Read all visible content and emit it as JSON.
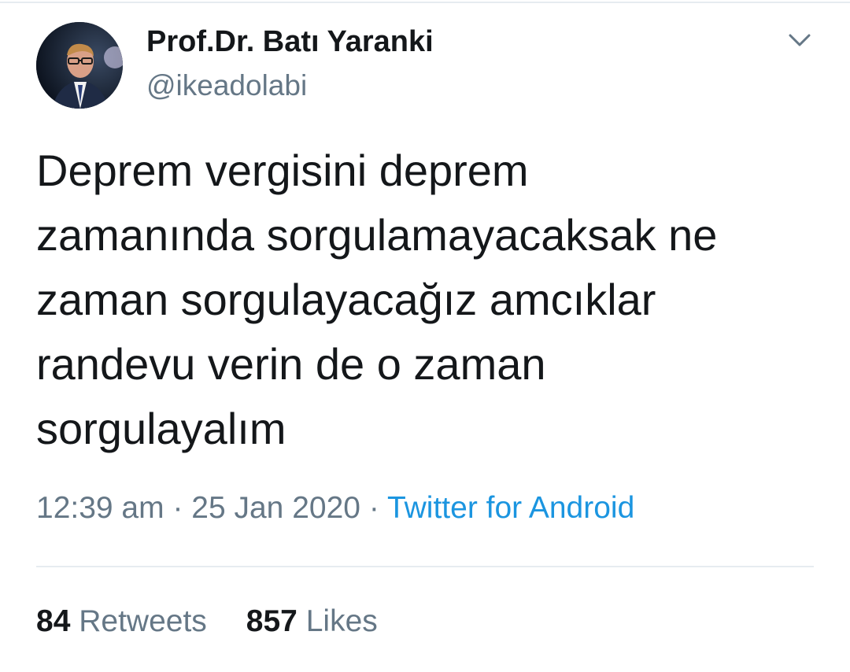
{
  "user": {
    "display_name": "Prof.Dr. Batı Yaranki",
    "handle": "@ikeadolabi",
    "avatar": "profile-photo"
  },
  "tweet": {
    "text": "Deprem vergisini deprem\nzamanında sorgulamayacaksak ne\nzaman sorgulayacağız amcıklar\nrandevu verin de o zaman\nsorgulayalım",
    "time": "12:39 am",
    "separator1": " · ",
    "date": "25 Jan 2020",
    "separator2": " · ",
    "source": "Twitter for Android"
  },
  "stats": {
    "retweets_count": "84",
    "retweets_label": " Retweets",
    "likes_count": "857",
    "likes_label": " Likes"
  },
  "icons": {
    "menu": "chevron-down-icon"
  },
  "colors": {
    "text_primary": "#14171a",
    "text_secondary": "#657786",
    "link": "#1b95e0",
    "divider": "#e6ecf0"
  }
}
